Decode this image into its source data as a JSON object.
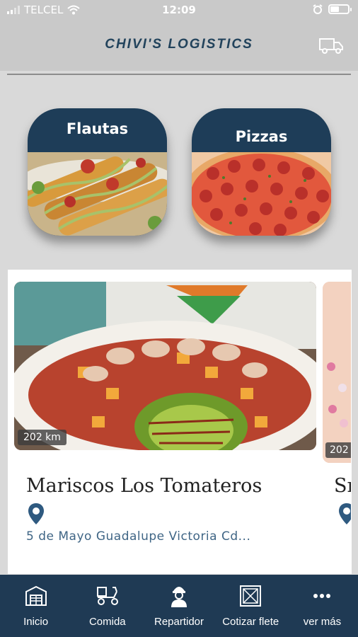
{
  "status_bar": {
    "carrier": "TELCEL",
    "time": "12:09"
  },
  "header": {
    "title": "CHIVI'S LOGISTICS",
    "truck_icon": "truck-icon"
  },
  "categories": [
    {
      "label": "Flautas"
    },
    {
      "label": "Pizzas"
    }
  ],
  "restaurants": [
    {
      "name": "Mariscos Los Tomateros",
      "address": "5 de Mayo Guadalupe Victoria Cd...",
      "distance": "202 km"
    },
    {
      "name": "Sr",
      "distance": "202"
    }
  ],
  "bottom_nav": [
    {
      "label": "Inicio",
      "icon": "warehouse-icon"
    },
    {
      "label": "Comida",
      "icon": "scooter-icon"
    },
    {
      "label": "Repartidor",
      "icon": "delivery-person-icon"
    },
    {
      "label": "Cotizar flete",
      "icon": "crate-icon"
    },
    {
      "label": "ver más",
      "icon": "more-icon"
    }
  ],
  "colors": {
    "primary": "#1f3a54",
    "header_bg": "#c9c9c9",
    "title": "#22435c",
    "address": "#3f6585"
  }
}
